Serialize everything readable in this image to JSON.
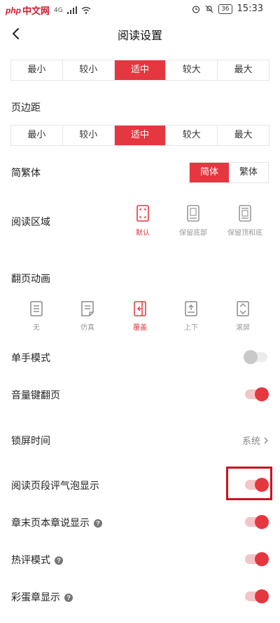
{
  "status_bar": {
    "logo_php": "php",
    "logo_cn": "中文网",
    "network": "4G",
    "battery": "36",
    "time": "15:33"
  },
  "header": {
    "title": "阅读设置"
  },
  "font_size": {
    "options": [
      "最小",
      "较小",
      "适中",
      "较大",
      "最大"
    ],
    "selected": "适中"
  },
  "margin": {
    "label": "页边距",
    "options": [
      "最小",
      "较小",
      "适中",
      "较大",
      "最大"
    ],
    "selected": "适中"
  },
  "conversion": {
    "label": "简繁体",
    "options": [
      "简体",
      "繁体"
    ],
    "selected": "简体"
  },
  "reading_area": {
    "label": "阅读区域",
    "options": [
      {
        "label": "默认",
        "icon": "default-area-icon"
      },
      {
        "label": "保留底部",
        "icon": "keep-bottom-icon"
      },
      {
        "label": "保留顶和底",
        "icon": "keep-top-bottom-icon"
      }
    ],
    "selected": "默认"
  },
  "page_animation": {
    "label": "翻页动画",
    "options": [
      {
        "label": "无",
        "icon": "none-page-icon"
      },
      {
        "label": "仿真",
        "icon": "simulate-page-icon"
      },
      {
        "label": "覆盖",
        "icon": "cover-page-icon"
      },
      {
        "label": "上下",
        "icon": "vertical-scroll-icon"
      },
      {
        "label": "滚屏",
        "icon": "auto-scroll-icon"
      }
    ],
    "selected": "覆盖"
  },
  "settings": {
    "one_hand": {
      "label": "单手模式",
      "on": false
    },
    "volume_key": {
      "label": "音量键翻页",
      "on": true
    },
    "lock_time": {
      "label": "锁屏时间",
      "value": "系统"
    },
    "bubble": {
      "label": "阅读页段评气泡显示",
      "on": true
    },
    "chapter_end": {
      "label": "章末页本章说显示",
      "on": true
    },
    "hot_comment": {
      "label": "热评模式",
      "on": true
    },
    "easter_egg": {
      "label": "彩蛋章显示",
      "on": true
    }
  },
  "colors": {
    "accent": "#e5373f",
    "highlight_box": "#c8141e"
  }
}
